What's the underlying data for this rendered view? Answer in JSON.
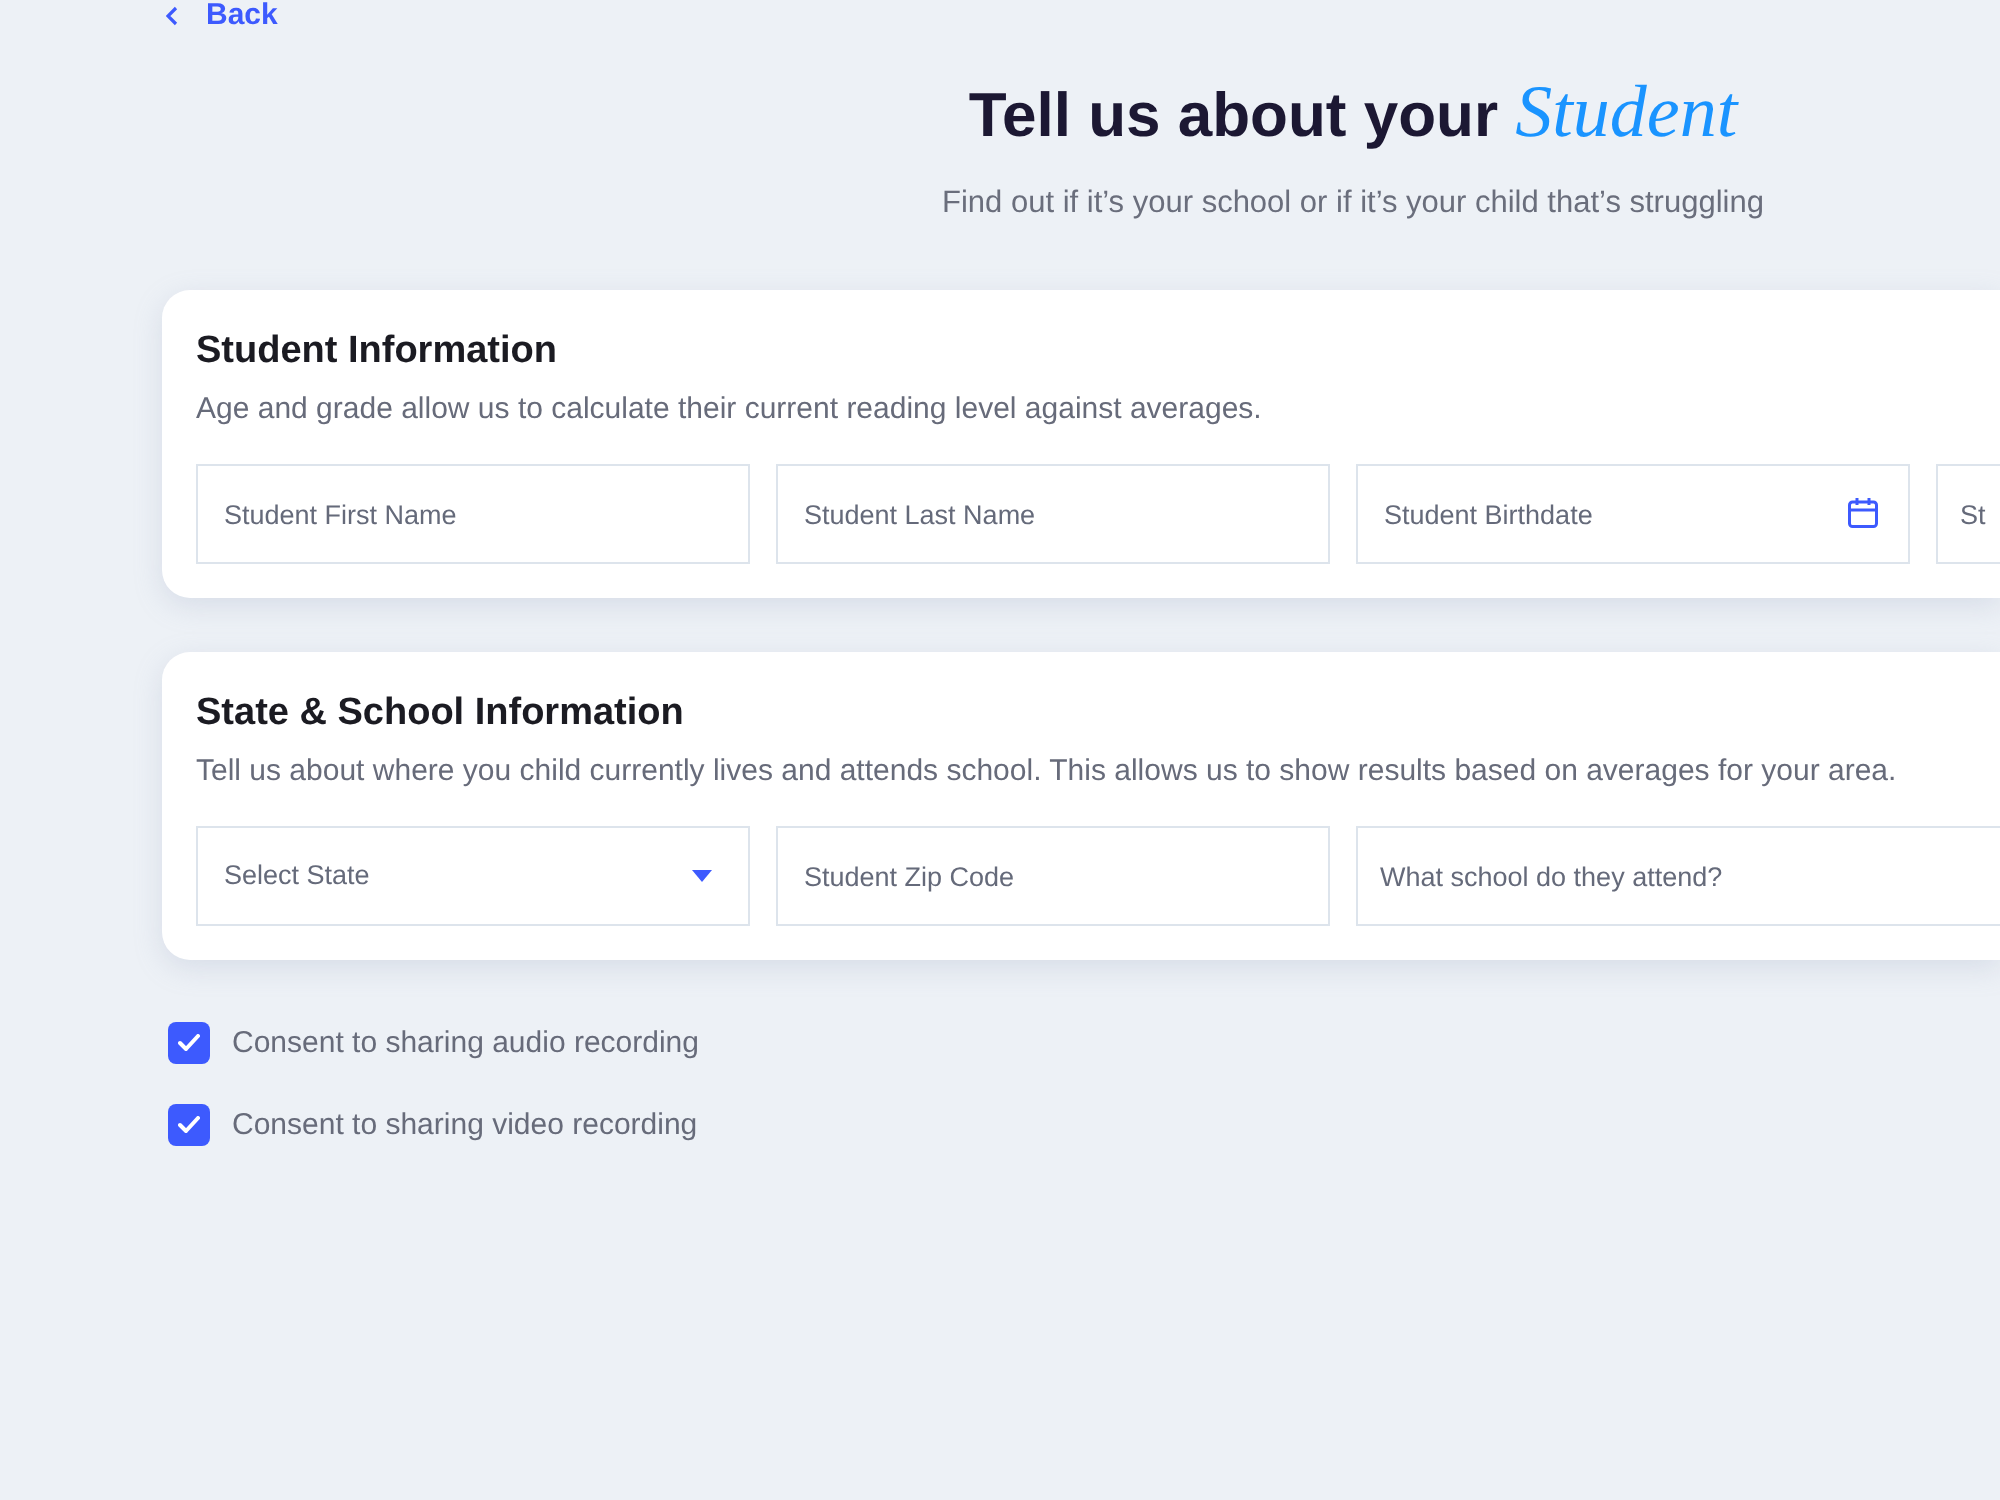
{
  "back_link": {
    "label": "Back"
  },
  "header": {
    "title": "Tell us about your",
    "title_highlight": "Student",
    "subtitle": "Find out if it’s your school or if it’s your child that’s struggling"
  },
  "sections": [
    {
      "title": "Student Information",
      "description": "Age and grade allow us to calculate their current reading level against averages.",
      "fields": [
        {
          "kind": "text",
          "placeholder": "Student First Name"
        },
        {
          "kind": "text",
          "placeholder": "Student Last Name"
        },
        {
          "kind": "date",
          "placeholder": "Student Birthdate"
        },
        {
          "kind": "text",
          "placeholder": "St"
        }
      ]
    },
    {
      "title": "State & School Information",
      "description": "Tell us about where you child currently lives and attends school. This allows us to show results based on averages for your area.",
      "fields": [
        {
          "kind": "select",
          "placeholder": "Select State"
        },
        {
          "kind": "text",
          "placeholder": "Student Zip Code"
        },
        {
          "kind": "text",
          "placeholder": "What school do they attend?"
        }
      ]
    }
  ],
  "consents": [
    {
      "label": "Consent to sharing audio recording",
      "checked": true
    },
    {
      "label": "Consent to sharing video recording",
      "checked": true
    }
  ]
}
